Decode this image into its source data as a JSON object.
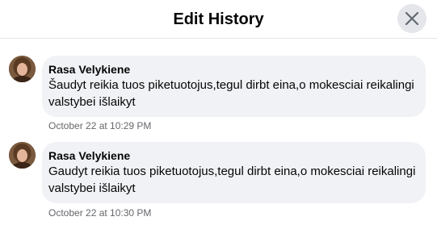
{
  "dialog": {
    "title": "Edit History",
    "close_icon": "close-icon"
  },
  "entries": [
    {
      "author": "Rasa Velykiene",
      "message": "Šaudyt reikia tuos piketuotojus,tegul dirbt eina,o mokesciai reikalingi valstybei išlaikyt",
      "timestamp": "October 22 at 10:29 PM"
    },
    {
      "author": "Rasa Velykiene",
      "message": "Gaudyt reikia tuos piketuotojus,tegul dirbt eina,o mokesciai reikalingi valstybei išlaikyt",
      "timestamp": "October 22 at 10:30 PM"
    }
  ],
  "colors": {
    "bubble_bg": "#f0f2f5",
    "close_button_bg": "#e4e6eb",
    "timestamp_text": "#65676b"
  }
}
